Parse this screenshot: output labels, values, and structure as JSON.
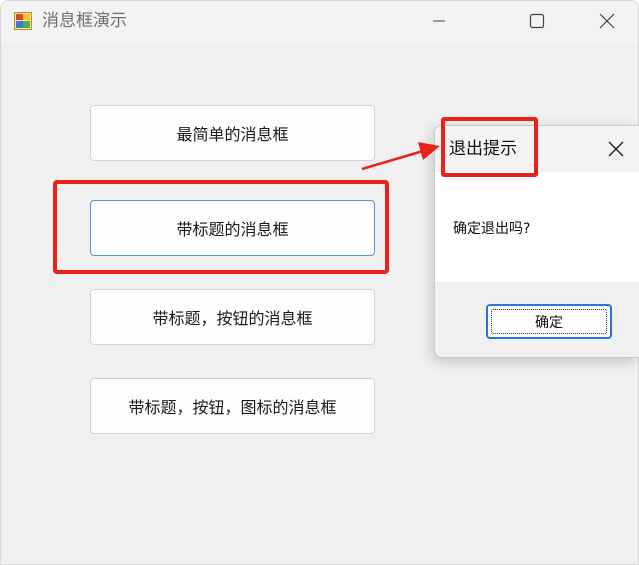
{
  "window": {
    "title": "消息框演示",
    "icon": "winforms-app-icon"
  },
  "titlebar_buttons": {
    "minimize": "minimize-icon",
    "maximize": "maximize-icon",
    "close": "close-icon"
  },
  "buttons": [
    {
      "label": "最简单的消息框"
    },
    {
      "label": "带标题的消息框"
    },
    {
      "label": "带标题，按钮的消息框"
    },
    {
      "label": "带标题，按钮，图标的消息框"
    }
  ],
  "dialog": {
    "title": "退出提示",
    "message": "确定退出吗?",
    "ok_label": "确定"
  },
  "annotation_colors": {
    "highlight": "#e8211b",
    "focus": "#2b74d6"
  }
}
